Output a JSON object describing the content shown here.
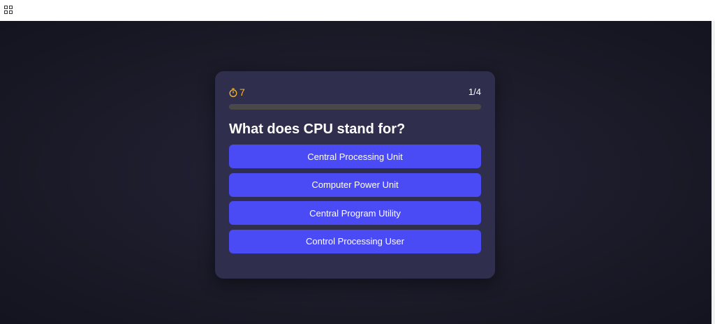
{
  "toolbar": {
    "icon": "grid-icon"
  },
  "quiz": {
    "timer": {
      "icon": "stopwatch-icon",
      "value": "7",
      "color": "#f5b82e"
    },
    "counter": "1/4",
    "progress": 0,
    "question": "What does CPU stand for?",
    "options": [
      "Central Processing Unit",
      "Computer Power Unit",
      "Central Program Utility",
      "Control Processing User"
    ]
  },
  "colors": {
    "accent": "#4b4bf5",
    "card": "#2f2f4d",
    "background": "#1b1b29"
  }
}
